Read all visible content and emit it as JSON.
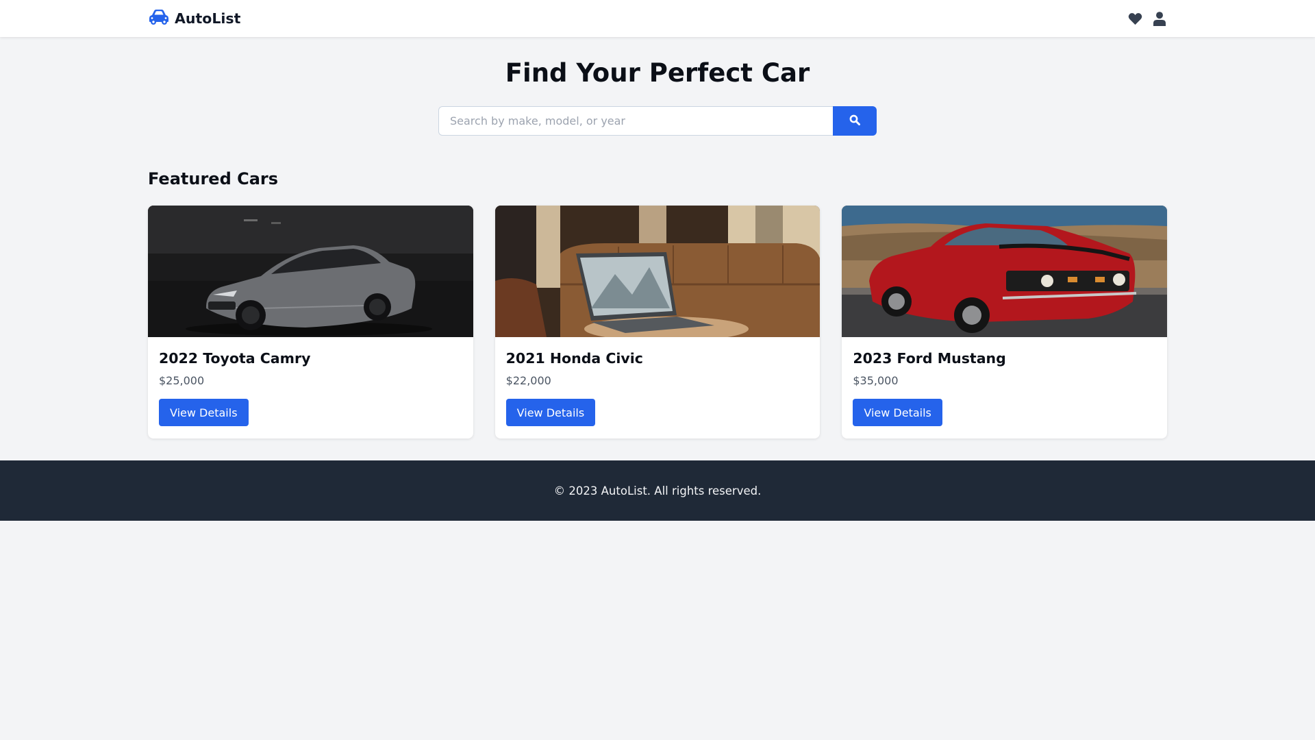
{
  "colors": {
    "accent": "#2563eb",
    "page_background": "#f3f4f6",
    "header_background": "#ffffff",
    "footer_background": "#1f2937"
  },
  "header": {
    "brand_icon": "car-icon",
    "brand_name": "AutoList",
    "actions": [
      {
        "icon": "heart-icon",
        "label": ""
      },
      {
        "icon": "user-icon",
        "label": ""
      }
    ]
  },
  "hero": {
    "title": "Find Your Perfect Car",
    "search": {
      "placeholder": "Search by make, model, or year",
      "value": "",
      "button_icon": "search-icon"
    }
  },
  "featured": {
    "title": "Featured Cars",
    "cards": [
      {
        "title": "2022 Toyota Camry",
        "price": "$25,000",
        "button_label": "View Details",
        "image": "gray sedan photo"
      },
      {
        "title": "2021 Honda Civic",
        "price": "$22,000",
        "button_label": "View Details",
        "image": "laptop on couch photo"
      },
      {
        "title": "2023 Ford Mustang",
        "price": "$35,000",
        "button_label": "View Details",
        "image": "red muscle car photo"
      }
    ]
  },
  "footer": {
    "text": "© 2023 AutoList. All rights reserved."
  }
}
